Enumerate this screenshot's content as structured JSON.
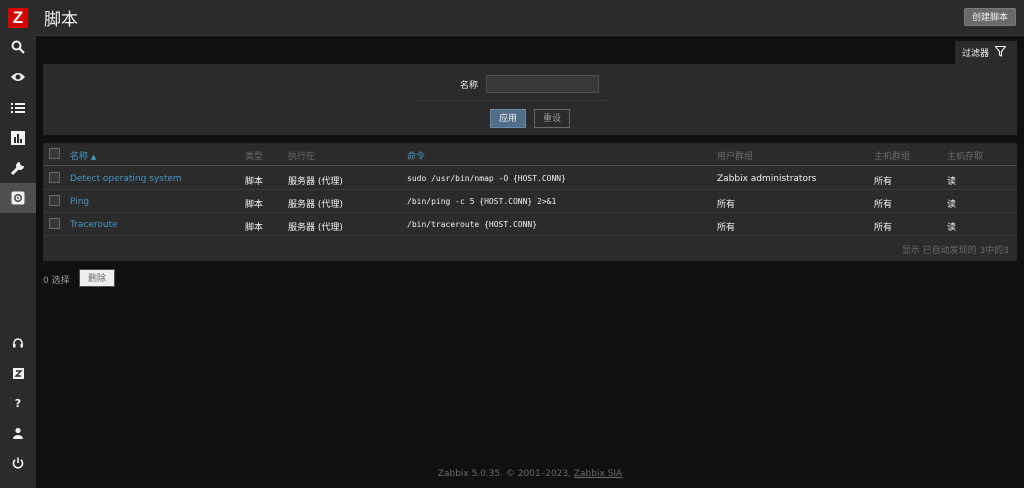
{
  "sidebar": {
    "logo": "Z",
    "items": [
      {
        "icon": "search-icon"
      },
      {
        "icon": "eye-icon"
      },
      {
        "icon": "list-icon"
      },
      {
        "icon": "chart-icon"
      },
      {
        "icon": "wrench-icon"
      },
      {
        "icon": "gear-icon"
      }
    ],
    "bottom_items": [
      {
        "icon": "support-icon"
      },
      {
        "icon": "zabbix-share-icon"
      },
      {
        "icon": "help-icon"
      },
      {
        "icon": "user-icon"
      },
      {
        "icon": "power-icon"
      }
    ],
    "help_label": "?"
  },
  "header": {
    "title": "脚本",
    "create_button": "创建脚本"
  },
  "filter": {
    "tab_label": "过滤器",
    "name_label": "名称",
    "name_value": "",
    "apply_button": "应用",
    "reset_button": "重设"
  },
  "table": {
    "columns": {
      "name": "名称",
      "type": "类型",
      "execute_on": "执行在",
      "command": "命令",
      "user_group": "用户群组",
      "host_group": "主机群组",
      "host_access": "主机存取"
    },
    "sort_indicator": "▲",
    "rows": [
      {
        "name": "Detect operating system",
        "type": "脚本",
        "execute_on": "服务器 (代理)",
        "command": "sudo /usr/bin/nmap -O {HOST.CONN}",
        "user_group": "Zabbix administrators",
        "host_group": "所有",
        "host_access": "读"
      },
      {
        "name": "Ping",
        "type": "脚本",
        "execute_on": "服务器 (代理)",
        "command": "/bin/ping -c 5 {HOST.CONN} 2>&1",
        "user_group": "所有",
        "host_group": "所有",
        "host_access": "读"
      },
      {
        "name": "Traceroute",
        "type": "脚本",
        "execute_on": "服务器 (代理)",
        "command": "/bin/traceroute {HOST.CONN}",
        "user_group": "所有",
        "host_group": "所有",
        "host_access": "读"
      }
    ],
    "summary": "显示 已自动发现的 3中的3"
  },
  "actions": {
    "selected_count": "0 选择",
    "delete_button": "删除"
  },
  "footer": {
    "text": "Zabbix 5.0.35. © 2001–2023, ",
    "company": "Zabbix SIA"
  },
  "colors": {
    "link": "#4796c4",
    "logo": "#d40000",
    "apply": "#4f6c88"
  }
}
